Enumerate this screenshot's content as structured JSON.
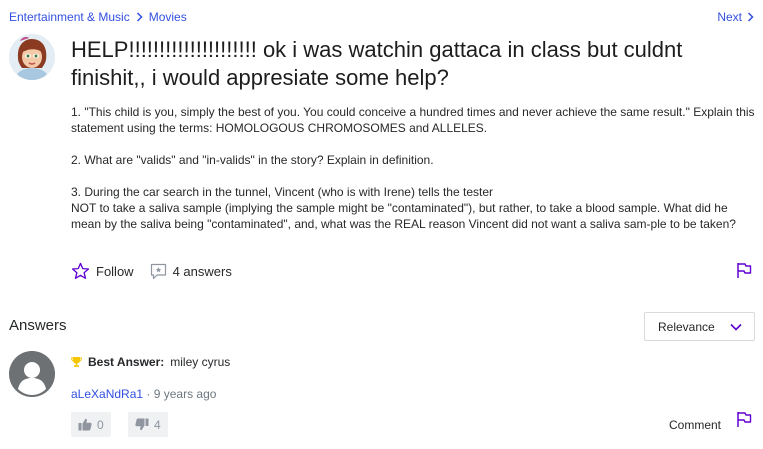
{
  "breadcrumb": {
    "category": "Entertainment & Music",
    "subcategory": "Movies"
  },
  "nav": {
    "next_label": "Next"
  },
  "question": {
    "title": "HELP!!!!!!!!!!!!!!!!!!!!! ok i was watchin gattaca in class but culdnt finishit,, i would appresiate some help?",
    "body": [
      "1. \"This child is you, simply the best of you. You could conceive a hundred times and never achieve the same result.\" Explain this statement using the terms: HOMOLOGOUS CHROMOSOMES and ALLELES.",
      "2. What are \"valids\" and \"in-valids\" in the story? Explain in definition.",
      "3. During the car search in the tunnel, Vincent (who is with Irene) tells the tester",
      "NOT to take a saliva sample (implying the sample might be \"contaminated\"), but rather, to take a blood sample. What did he mean by the saliva being \"contaminated\", and, what was the REAL reason Vincent did not want a saliva sam-ple to be taken?"
    ],
    "follow_label": "Follow",
    "answers_count_label": "4 answers"
  },
  "answers_section": {
    "title": "Answers",
    "sort_label": "Relevance"
  },
  "best_answer": {
    "label": "Best Answer:",
    "text": "miley cyrus",
    "author": "aLeXaNdRa1",
    "time": "9 years ago",
    "upvotes": "0",
    "downvotes": "4",
    "comment_label": "Comment"
  },
  "colors": {
    "link": "#324fe1",
    "accent_purple": "#6001d2",
    "trophy": "#f5c500",
    "text": "#26282a"
  },
  "icons": {
    "breadcrumb_sep": "chevron-right-icon",
    "next": "chevron-right-icon",
    "follow": "star-outline-icon",
    "answers": "speech-bubble-icon",
    "flag": "flag-icon",
    "sort": "chevron-down-icon",
    "best_answer": "trophy-icon",
    "upvote": "thumbs-up-icon",
    "downvote": "thumbs-down-icon"
  }
}
